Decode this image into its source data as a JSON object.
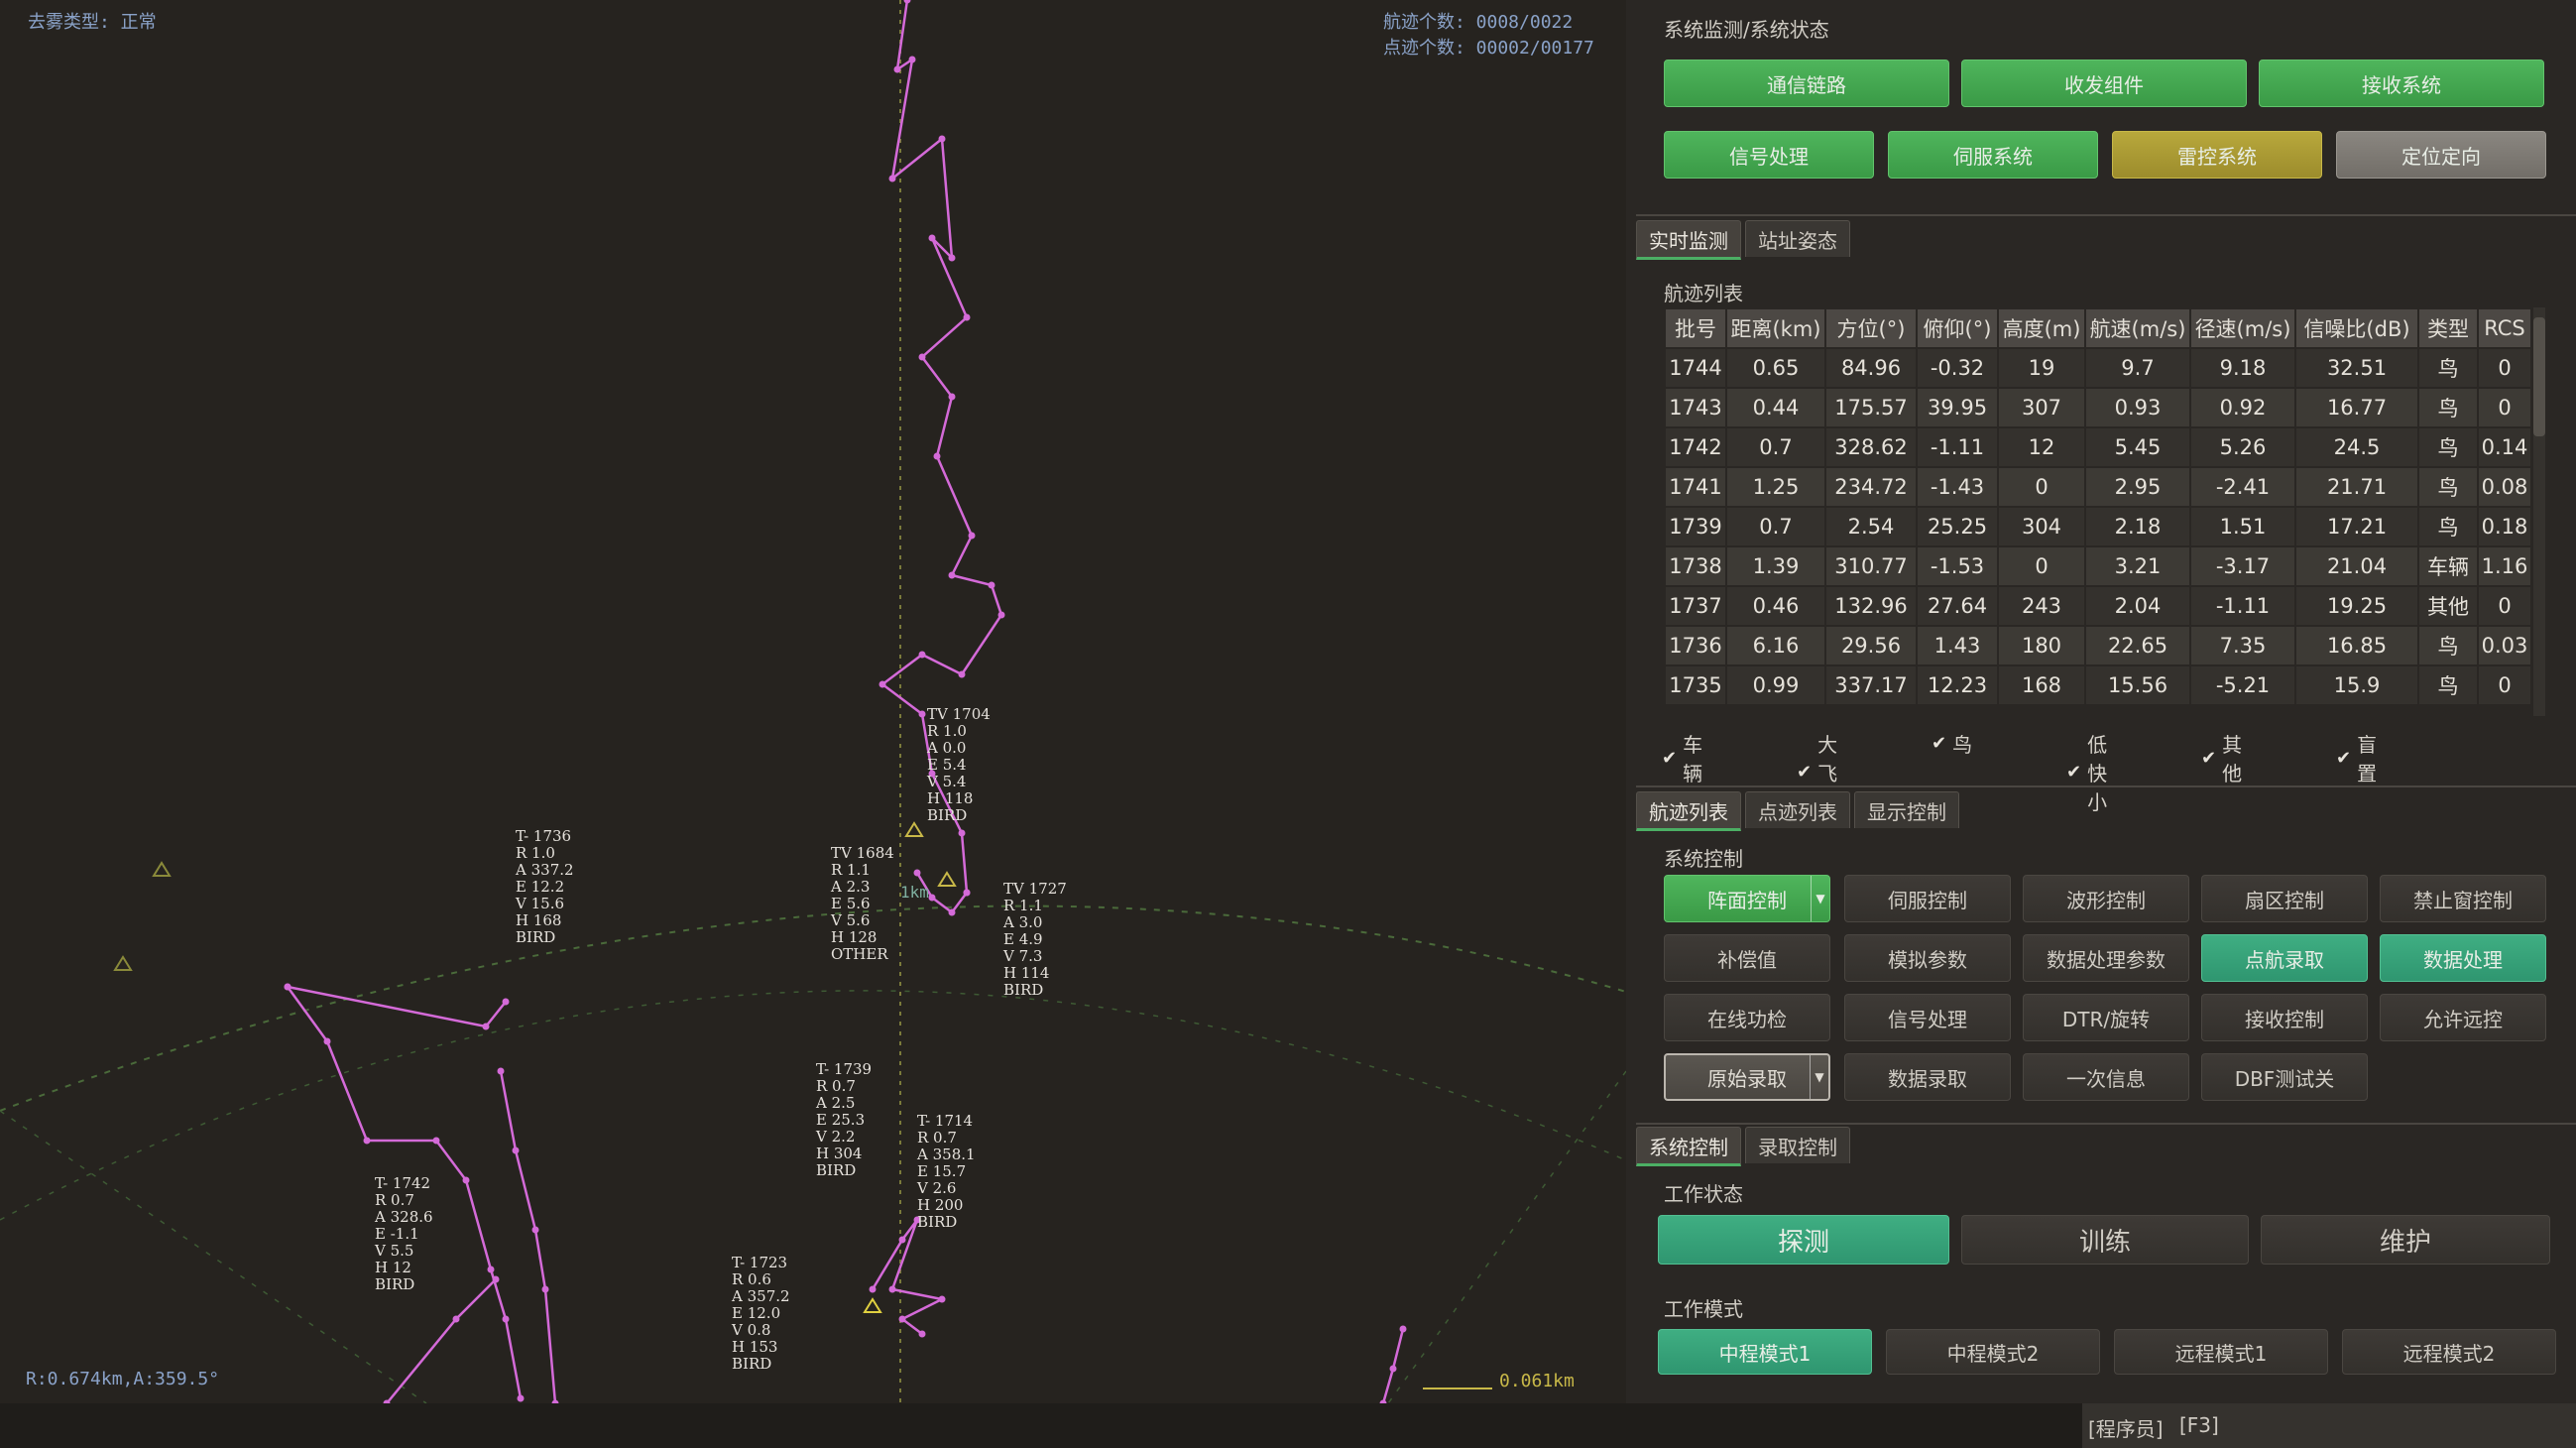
{
  "radar": {
    "filter_type": "去雾类型: 正常",
    "track_count": "航迹个数: 0008/0022",
    "plot_count": "点迹个数: 00002/00177",
    "cursor_readout": "R:0.674km,A:359.5°",
    "scale_label": "0.061km",
    "range_ring_label": "1km",
    "targets": [
      {
        "lines": "T- 1736\nR 1.0\nA 337.2\nE 12.2\nV 15.6\nH 168\nBIRD"
      },
      {
        "lines": "TV 1684\nR 1.1\nA 2.3\nE 5.6\nV 5.6\nH 128\nOTHER"
      },
      {
        "lines": "TV 1704\nR 1.0\nA 0.0\nE 5.4\nV 5.4\nH 118\nBIRD"
      },
      {
        "lines": "TV 1727\nR 1.1\nA 3.0\nE 4.9\nV 7.3\nH 114\nBIRD"
      },
      {
        "lines": "T- 1739\nR 0.7\nA 2.5\nE 25.3\nV 2.2\nH 304\nBIRD"
      },
      {
        "lines": "T- 1714\nR 0.7\nA 358.1\nE 15.7\nV 2.6\nH 200\nBIRD"
      },
      {
        "lines": "T- 1742\nR 0.7\nA 328.6\nE -1.1\nV 5.5\nH 12\nBIRD"
      },
      {
        "lines": "T- 1723\nR 0.6\nA 357.2\nE 12.0\nV 0.8\nH 153\nBIRD"
      }
    ]
  },
  "system_status": {
    "title": "系统监测/系统状态",
    "row1": [
      "通信链路",
      "收发组件",
      "接收系统"
    ],
    "row2": [
      "信号处理",
      "伺服系统",
      "雷控系统",
      "定位定向"
    ]
  },
  "monitor_tabs": [
    "实时监测",
    "站址姿态"
  ],
  "track_list": {
    "title": "航迹列表",
    "headers": [
      "批号",
      "距离(km)",
      "方位(°)",
      "俯仰(°)",
      "高度(m)",
      "航速(m/s)",
      "径速(m/s)",
      "信噪比(dB)",
      "类型",
      "RCS"
    ],
    "rows": [
      [
        "1744",
        "0.65",
        "84.96",
        "-0.32",
        "19",
        "9.7",
        "9.18",
        "32.51",
        "鸟",
        "0"
      ],
      [
        "1743",
        "0.44",
        "175.57",
        "39.95",
        "307",
        "0.93",
        "0.92",
        "16.77",
        "鸟",
        "0"
      ],
      [
        "1742",
        "0.7",
        "328.62",
        "-1.11",
        "12",
        "5.45",
        "5.26",
        "24.5",
        "鸟",
        "0.14"
      ],
      [
        "1741",
        "1.25",
        "234.72",
        "-1.43",
        "0",
        "2.95",
        "-2.41",
        "21.71",
        "鸟",
        "0.08"
      ],
      [
        "1739",
        "0.7",
        "2.54",
        "25.25",
        "304",
        "2.18",
        "1.51",
        "17.21",
        "鸟",
        "0.18"
      ],
      [
        "1738",
        "1.39",
        "310.77",
        "-1.53",
        "0",
        "3.21",
        "-3.17",
        "21.04",
        "车辆",
        "1.16"
      ],
      [
        "1737",
        "0.46",
        "132.96",
        "27.64",
        "243",
        "2.04",
        "-1.11",
        "19.25",
        "其他",
        "0"
      ],
      [
        "1736",
        "6.16",
        "29.56",
        "1.43",
        "180",
        "22.65",
        "7.35",
        "16.85",
        "鸟",
        "0.03"
      ],
      [
        "1735",
        "0.99",
        "337.17",
        "12.23",
        "168",
        "15.56",
        "-5.21",
        "15.9",
        "鸟",
        "0"
      ]
    ]
  },
  "filters": [
    "车辆",
    "大飞机",
    "鸟",
    "低快小",
    "其他",
    "盲置"
  ],
  "control_tabs": [
    "航迹列表",
    "点迹列表",
    "显示控制"
  ],
  "system_control": {
    "title": "系统控制",
    "row1": [
      "阵面控制",
      "伺服控制",
      "波形控制",
      "扇区控制",
      "禁止窗控制"
    ],
    "row2": [
      "补偿值",
      "模拟参数",
      "数据处理参数",
      "点航录取",
      "数据处理"
    ],
    "row3": [
      "在线功检",
      "信号处理",
      "DTR/旋转",
      "接收控制",
      "允许远控"
    ],
    "row4": [
      "原始录取",
      "数据录取",
      "一次信息",
      "DBF测试关"
    ]
  },
  "bottom_tabs": [
    "系统控制",
    "录取控制"
  ],
  "work_state": {
    "title": "工作状态",
    "buttons": [
      "探测",
      "训练",
      "维护"
    ]
  },
  "work_mode": {
    "title": "工作模式",
    "buttons": [
      "中程模式1",
      "中程模式2",
      "远程模式1",
      "远程模式2"
    ]
  },
  "statusbar": {
    "user": "[程序员]",
    "key": "[F3]"
  },
  "colors": {
    "track": "#d46ad8",
    "green_button": "#4fb55c",
    "teal_button": "#3fae82",
    "yellow_button": "#b8a83c"
  }
}
